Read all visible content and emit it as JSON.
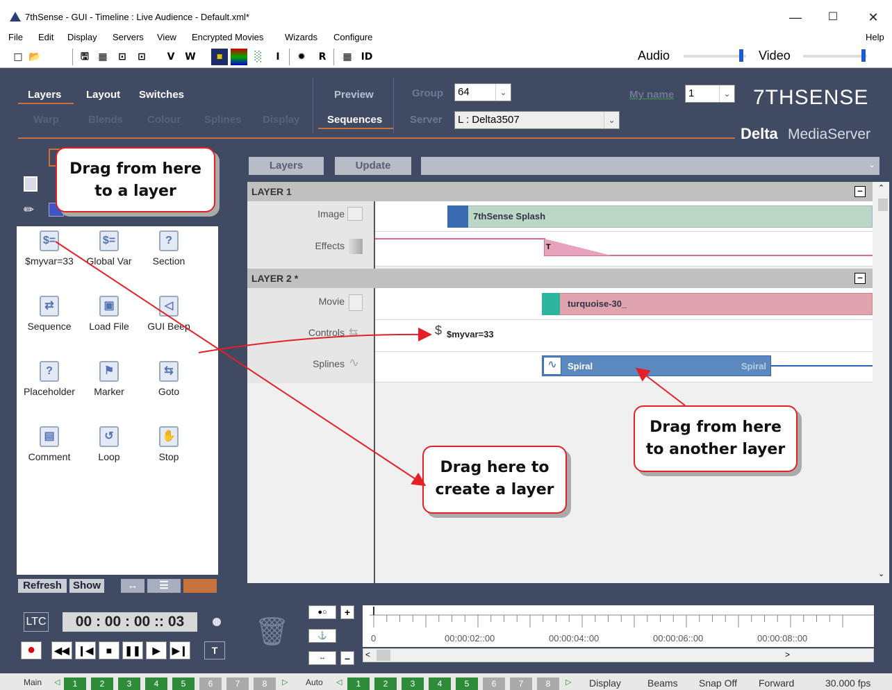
{
  "window": {
    "title": "7thSense -  GUI  - Timeline : Live Audience  - Default.xml*"
  },
  "menu": [
    "File",
    "Edit",
    "Display",
    "Servers",
    "View",
    "Encrypted Movies",
    "Wizards",
    "Configure"
  ],
  "menu_help": "Help",
  "toolbar": {
    "items": [
      "V",
      "W",
      "I",
      "R",
      "ID"
    ],
    "audio_label": "Audio",
    "video_label": "Video",
    "audio_level": 0.92,
    "video_level": 0.95
  },
  "tabs": {
    "row1": [
      "Layers",
      "Layout",
      "Switches"
    ],
    "row2": [
      "Warp",
      "Blends",
      "Colour",
      "Splines",
      "Display"
    ],
    "preview": "Preview",
    "sequences": "Sequences"
  },
  "group": {
    "label": "Group",
    "value": "64"
  },
  "server": {
    "label": "Server",
    "value": "L : Delta3507"
  },
  "myname": {
    "label": "My name",
    "value": "1"
  },
  "brand": {
    "logo": "7THSENSE",
    "product_bold": "Delta",
    "product_light": "MediaServer"
  },
  "tools": [
    {
      "label": "$myvar=33",
      "icon": "dollar-icon"
    },
    {
      "label": "Global Var",
      "icon": "dollar-icon"
    },
    {
      "label": "Section",
      "icon": "question-icon"
    },
    {
      "label": "Sequence",
      "icon": "sequence-icon"
    },
    {
      "label": "Load File",
      "icon": "floppy-icon"
    },
    {
      "label": "GUI Beep",
      "icon": "speaker-icon"
    },
    {
      "label": "Placeholder",
      "icon": "question-icon"
    },
    {
      "label": "Marker",
      "icon": "flag-icon"
    },
    {
      "label": "Goto",
      "icon": "goto-arrow-icon"
    },
    {
      "label": "Comment",
      "icon": "page-icon"
    },
    {
      "label": "Loop",
      "icon": "loop-icon"
    },
    {
      "label": "Stop",
      "icon": "hand-icon"
    }
  ],
  "panel_buttons": {
    "refresh": "Refresh",
    "show": "Show"
  },
  "timeline_buttons": {
    "layers": "Layers",
    "update": "Update"
  },
  "layers": [
    {
      "name": "LAYER 1",
      "tracks": [
        {
          "label": "Image",
          "clip": "7thSense Splash"
        },
        {
          "label": "Effects",
          "clip": "T"
        }
      ]
    },
    {
      "name": "LAYER 2 *",
      "tracks": [
        {
          "label": "Movie",
          "clip": "turquoise-30_"
        },
        {
          "label": "Controls",
          "clip": "$myvar=33"
        },
        {
          "label": "Splines",
          "clip": "Spiral",
          "clip_end": "Spiral"
        }
      ]
    }
  ],
  "callouts": {
    "c1": [
      "Drag from here",
      "to a layer"
    ],
    "c2": [
      "Drag here to",
      "create a layer"
    ],
    "c3": [
      "Drag from here",
      "to another layer"
    ]
  },
  "timecode": {
    "label": "LTC",
    "value": "00 : 00 : 00 :: 03"
  },
  "ruler": [
    "0",
    "00:00:02::00",
    "00:00:04::00",
    "00:00:06::00",
    "00:00:08::00"
  ],
  "statusbar": {
    "main_label": "Main",
    "main_nums": [
      "1",
      "2",
      "3",
      "4",
      "5",
      "6",
      "7",
      "8"
    ],
    "auto_label": "Auto",
    "auto_nums": [
      "1",
      "2",
      "3",
      "4",
      "5",
      "6",
      "7",
      "8"
    ],
    "items": [
      "Display",
      "Beams",
      "Snap Off",
      "Forward",
      "30.000 fps"
    ]
  },
  "colors": {
    "panel_bg": "#404b63",
    "accent": "#c7733e",
    "callout_border": "#e41f26"
  }
}
